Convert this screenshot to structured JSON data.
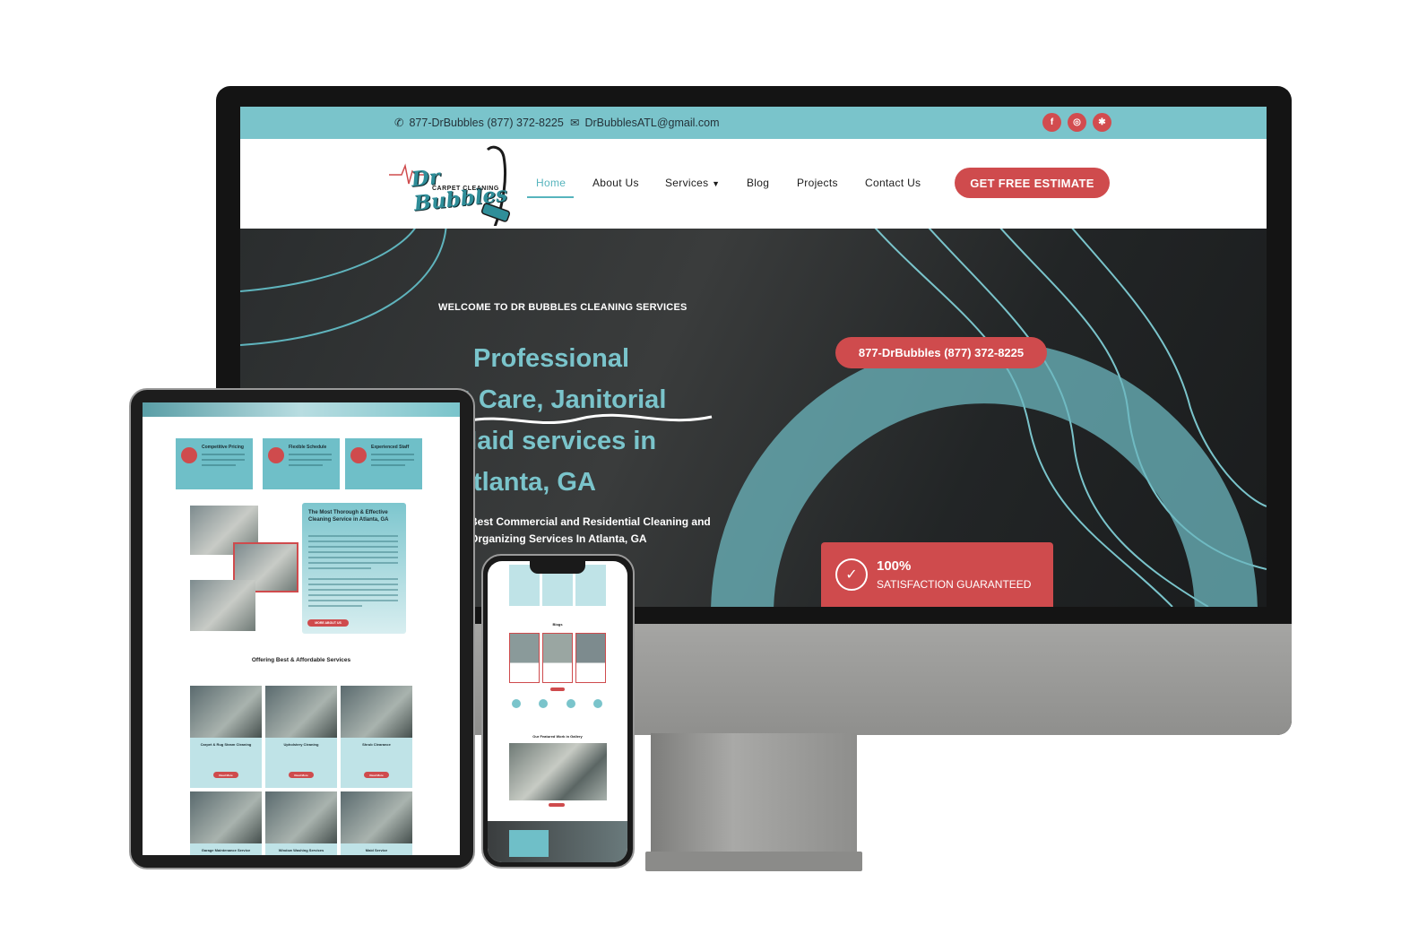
{
  "desktop": {
    "topbar": {
      "phone": "877-DrBubbles (877) 372-8225",
      "email": "DrBubblesATL@gmail.com",
      "social": [
        {
          "name": "facebook-icon",
          "glyph": "f"
        },
        {
          "name": "instagram-icon",
          "glyph": "◎"
        },
        {
          "name": "yelp-icon",
          "glyph": "✱"
        }
      ]
    },
    "logo": {
      "brand": "Dr Bubbles",
      "sub": "CARPET CLEANING"
    },
    "nav": {
      "home": "Home",
      "about": "About Us",
      "services": "Services",
      "blog": "Blog",
      "projects": "Projects",
      "contact": "Contact Us",
      "cta": "GET FREE ESTIMATE"
    },
    "hero": {
      "welcome": "WELCOME TO DR BUBBLES CLEANING SERVICES",
      "headline_1": "Professional",
      "headline_2": "et Care, Janitorial",
      "headline_3": " Maid services in",
      "headline_4": " Atlanta, GA",
      "tagline_1": "Best Commercial and Residential Cleaning and",
      "tagline_2": "Organizing Services In Atlanta, GA",
      "phone_button": "877-DrBubbles (877) 372-8225",
      "guarantee_pct": "100%",
      "guarantee_text": "SATISFACTION GUARANTEED"
    }
  },
  "tablet": {
    "features": [
      {
        "title": "Competitive Pricing"
      },
      {
        "title": "Flexible Schedule"
      },
      {
        "title": "Experienced Staff"
      }
    ],
    "about_card": {
      "title": "The Most Thorough & Effective Cleaning Service in Atlanta, GA",
      "button": "MORE ABOUT US"
    },
    "services_heading": "Offering Best & Affordable Services",
    "services": [
      {
        "name": "Carpet & Rug Steam Cleaning",
        "button": "Read More"
      },
      {
        "name": "Upholstery Cleaning",
        "button": "Read More"
      },
      {
        "name": "Shrub Clearance",
        "button": "Read More"
      },
      {
        "name": "Garage Maintenance Service",
        "button": ""
      },
      {
        "name": "Window Washing Services",
        "button": ""
      },
      {
        "name": "Maid Service",
        "button": ""
      }
    ]
  },
  "phone": {
    "blogs_heading": "Blogs",
    "gallery_heading": "Our Featured Work in Gallery"
  },
  "colors": {
    "teal": "#7ac4cb",
    "red": "#cf4b4d",
    "dark": "#1f2325"
  }
}
